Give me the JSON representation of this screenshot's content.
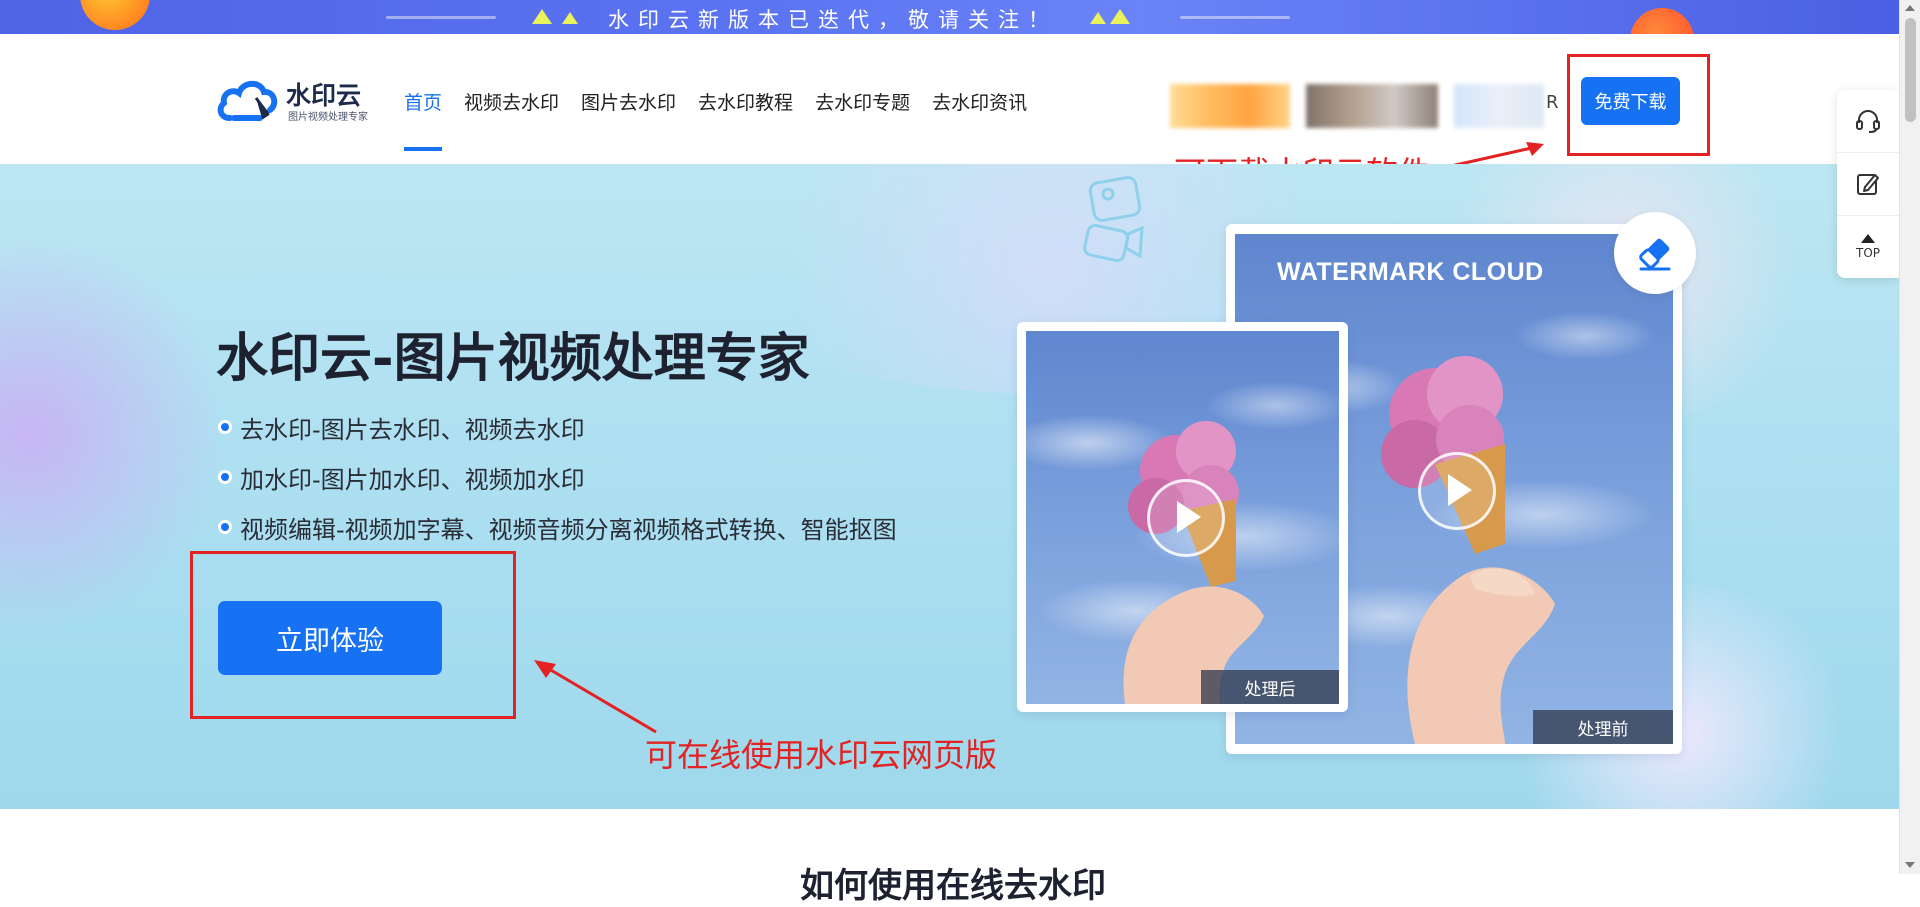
{
  "banner": {
    "text": "水印云新版本已迭代，敬请关注！"
  },
  "header": {
    "logo_title": "水印云",
    "logo_sub": "图片视频处理专家",
    "nav": [
      {
        "label": "首页",
        "active": true
      },
      {
        "label": "视频去水印"
      },
      {
        "label": "图片去水印"
      },
      {
        "label": "去水印教程"
      },
      {
        "label": "去水印专题"
      },
      {
        "label": "去水印资讯"
      }
    ],
    "blur_tail": "R",
    "download_label": "免费下载"
  },
  "annotations": {
    "download_note": "可下载水印云软件",
    "web_note": "可在线使用水印云网页版"
  },
  "hero": {
    "title": "水印云-图片视频处理专家",
    "bullets": [
      "去水印-图片去水印、视频去水印",
      "加水印-图片加水印、视频加水印",
      "视频编辑-视频加字幕、视频音频分离视频格式转换、智能抠图"
    ],
    "cta_label": "立即体验",
    "front_tag": "处理后",
    "back_tag": "处理前",
    "watermark_text": "WATERMARK CLOUD"
  },
  "side_tools": {
    "top_label": "TOP"
  },
  "next_section": {
    "title": "如何使用在线去水印"
  },
  "colors": {
    "primary": "#1672f3",
    "annotation_red": "#e32323"
  }
}
